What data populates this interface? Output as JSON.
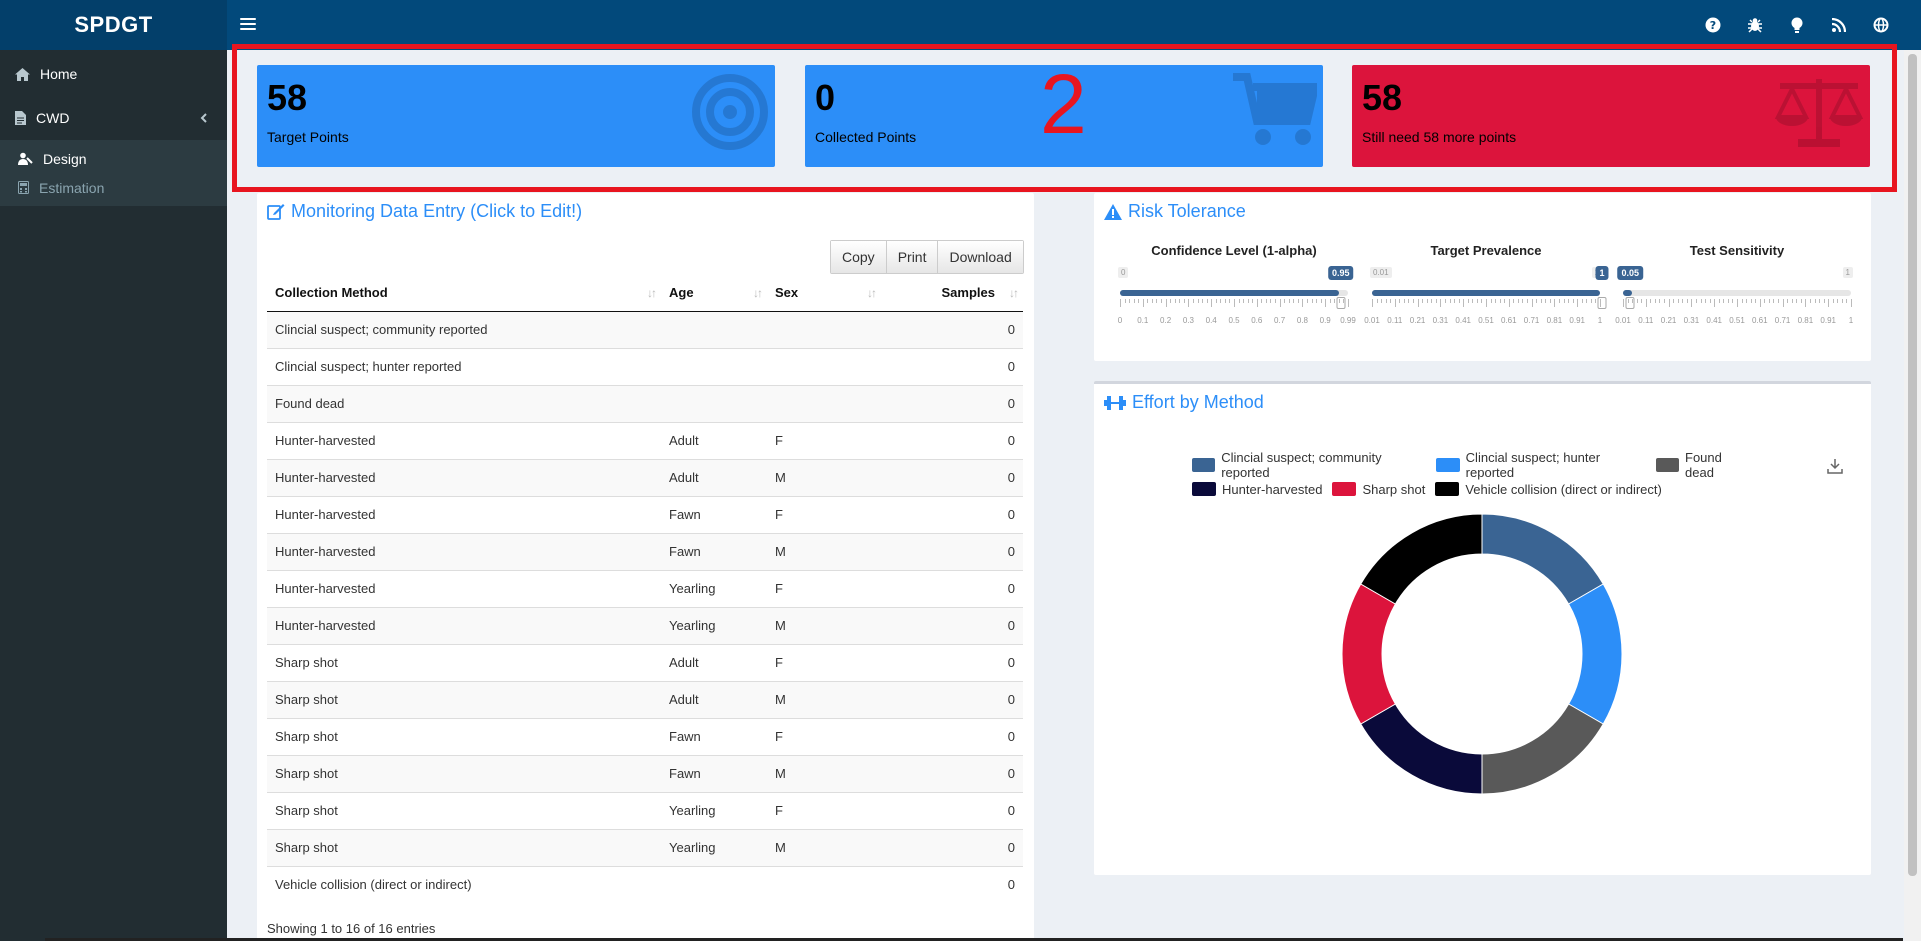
{
  "app": {
    "brand": "SPDGT"
  },
  "sidebar": {
    "items": [
      {
        "label": "Home",
        "icon": "home-icon"
      },
      {
        "label": "CWD",
        "icon": "file-icon"
      }
    ],
    "subitems": [
      {
        "label": "Design",
        "icon": "design-icon",
        "active": true
      },
      {
        "label": "Estimation",
        "icon": "calculator-icon",
        "active": false
      }
    ]
  },
  "value_boxes": [
    {
      "value": "58",
      "label": "Target Points",
      "icon": "bullseye-icon",
      "color": "#2c8ef8"
    },
    {
      "value": "0",
      "label": "Collected Points",
      "icon": "cart-icon",
      "color": "#2c8ef8"
    },
    {
      "value": "58",
      "label": "Still need 58 more points",
      "icon": "balance-scale-icon",
      "color": "#dc143c"
    }
  ],
  "annotation_number": "2",
  "monitoring": {
    "title": "Monitoring Data Entry (Click to Edit!)",
    "buttons": [
      "Copy",
      "Print",
      "Download"
    ],
    "columns": [
      "Collection Method",
      "Age",
      "Sex",
      "Samples"
    ],
    "rows": [
      [
        "Clincial suspect; community reported",
        "",
        "",
        "0"
      ],
      [
        "Clincial suspect; hunter reported",
        "",
        "",
        "0"
      ],
      [
        "Found dead",
        "",
        "",
        "0"
      ],
      [
        "Hunter-harvested",
        "Adult",
        "F",
        "0"
      ],
      [
        "Hunter-harvested",
        "Adult",
        "M",
        "0"
      ],
      [
        "Hunter-harvested",
        "Fawn",
        "F",
        "0"
      ],
      [
        "Hunter-harvested",
        "Fawn",
        "M",
        "0"
      ],
      [
        "Hunter-harvested",
        "Yearling",
        "F",
        "0"
      ],
      [
        "Hunter-harvested",
        "Yearling",
        "M",
        "0"
      ],
      [
        "Sharp shot",
        "Adult",
        "F",
        "0"
      ],
      [
        "Sharp shot",
        "Adult",
        "M",
        "0"
      ],
      [
        "Sharp shot",
        "Fawn",
        "F",
        "0"
      ],
      [
        "Sharp shot",
        "Fawn",
        "M",
        "0"
      ],
      [
        "Sharp shot",
        "Yearling",
        "F",
        "0"
      ],
      [
        "Sharp shot",
        "Yearling",
        "M",
        "0"
      ],
      [
        "Vehicle collision (direct or indirect)",
        "",
        "",
        "0"
      ]
    ],
    "info": "Showing 1 to 16 of 16 entries"
  },
  "risk": {
    "title": "Risk Tolerance",
    "sliders": [
      {
        "title": "Confidence Level (1-alpha)",
        "min": "0",
        "max": "0.99",
        "value": "0.95",
        "fraction": 0.96,
        "ticks": [
          "0",
          "0.1",
          "0.2",
          "0.3",
          "0.4",
          "0.5",
          "0.6",
          "0.7",
          "0.8",
          "0.9",
          "0.99"
        ]
      },
      {
        "title": "Target Prevalence",
        "min": "0.01",
        "max": "1",
        "value": "1",
        "fraction": 1.0,
        "ticks": [
          "0.01",
          "0.11",
          "0.21",
          "0.31",
          "0.41",
          "0.51",
          "0.61",
          "0.71",
          "0.81",
          "0.91",
          "1"
        ]
      },
      {
        "title": "Test Sensitivity",
        "min": "0.05",
        "max": "1",
        "value": "0.05",
        "fraction": 0.04,
        "ticks": [
          "0.01",
          "0.11",
          "0.21",
          "0.31",
          "0.41",
          "0.51",
          "0.61",
          "0.71",
          "0.81",
          "0.91",
          "1"
        ]
      }
    ]
  },
  "effort": {
    "title": "Effort by Method"
  },
  "chart_data": {
    "type": "pie",
    "donut": true,
    "legend_position": "top",
    "categories": [
      "Clincial suspect; community reported",
      "Clincial suspect; hunter reported",
      "Found dead",
      "Hunter-harvested",
      "Sharp shot",
      "Vehicle collision (direct or indirect)"
    ],
    "values": [
      1,
      1,
      1,
      1,
      1,
      1
    ],
    "colors": [
      "#3a6493",
      "#2c8ef8",
      "#595959",
      "#0a0a3a",
      "#dc143c",
      "#000000"
    ]
  }
}
